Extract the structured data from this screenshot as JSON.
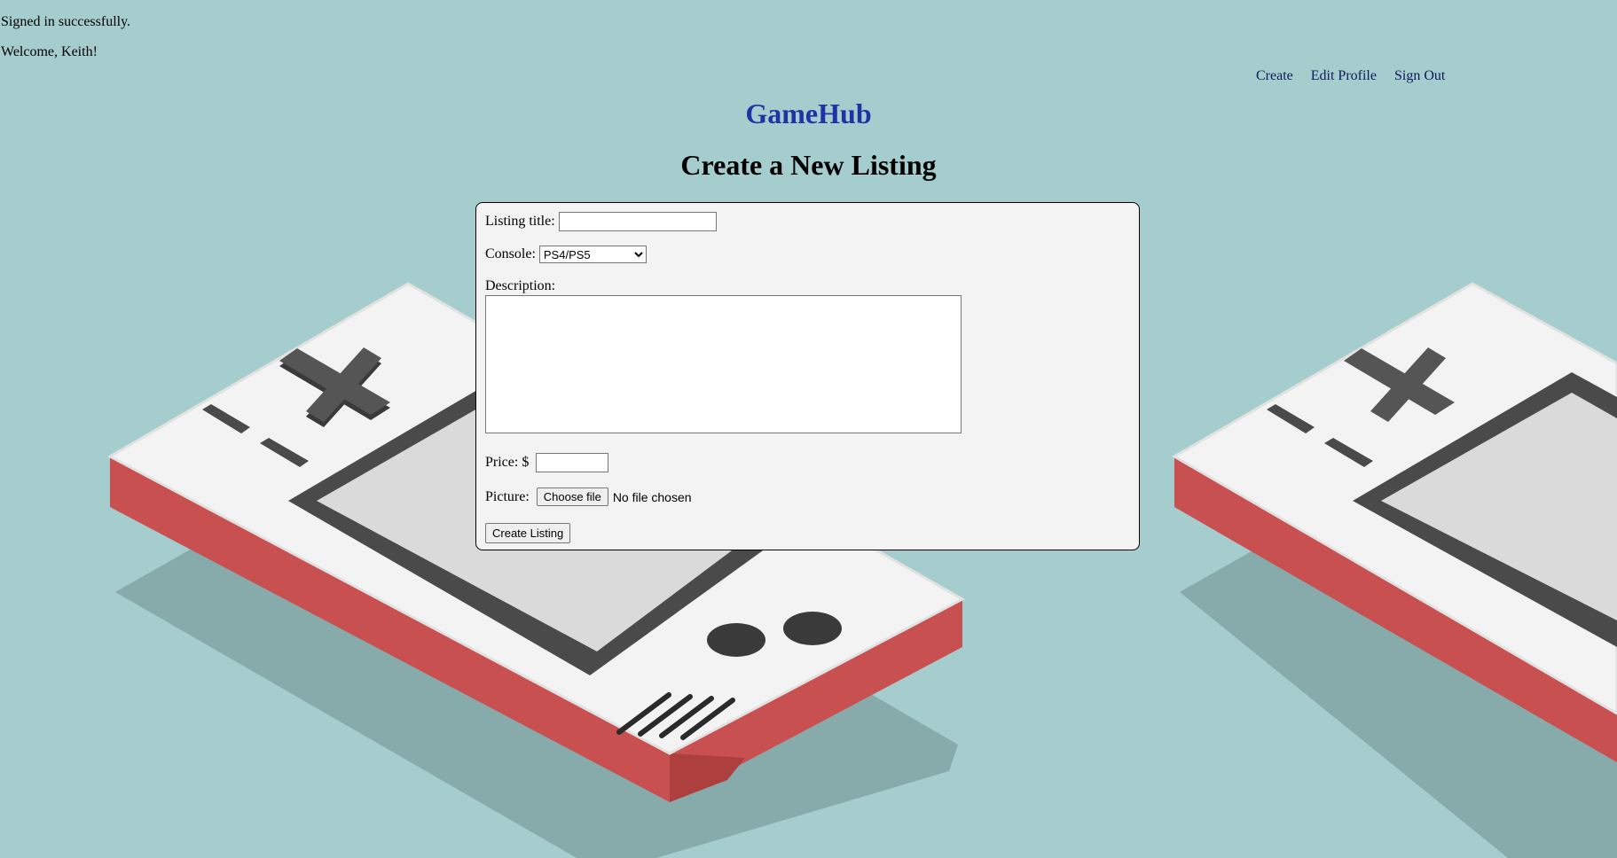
{
  "flash": {
    "notice": "Signed in successfully.",
    "welcome": "Welcome, Keith!"
  },
  "nav": {
    "create": "Create",
    "edit_profile": "Edit Profile",
    "sign_out": "Sign Out"
  },
  "brand": "GameHub",
  "page_title": "Create a New Listing",
  "form": {
    "title_label": "Listing title:",
    "title_value": "",
    "console_label": "Console:",
    "console_selected": "PS4/PS5",
    "description_label": "Description:",
    "description_value": "",
    "price_label": "Price: $",
    "price_value": "",
    "picture_label": "Picture:",
    "file_button": "Choose file",
    "file_status": "No file chosen",
    "submit_label": "Create Listing"
  },
  "colors": {
    "background": "#a6cdce",
    "brand": "#1d35a3",
    "nav_link": "#0b1a5c",
    "panel": "#f3f3f3",
    "console_body": "#f3f3f3",
    "console_side": "#c85051",
    "dpad": "#4a4a4a"
  }
}
